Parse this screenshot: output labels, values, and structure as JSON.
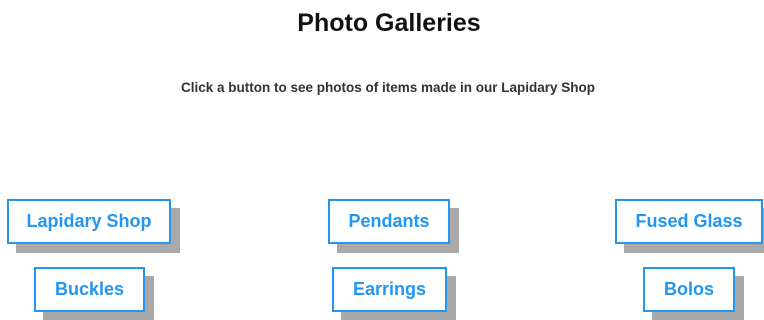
{
  "header": {
    "title": "Photo Galleries",
    "intro": "Click a button to see photos of items made in our Lapidary Shop"
  },
  "gallery_buttons": [
    {
      "label": "Lapidary Shop"
    },
    {
      "label": "Pendants"
    },
    {
      "label": "Fused Glass"
    },
    {
      "label": "Buckles"
    },
    {
      "label": "Earrings"
    },
    {
      "label": "Bolos"
    }
  ],
  "colors": {
    "accent": "#2196f3",
    "shadow": "#a9a9a9",
    "title_text": "#111111",
    "body_text": "#333333"
  }
}
